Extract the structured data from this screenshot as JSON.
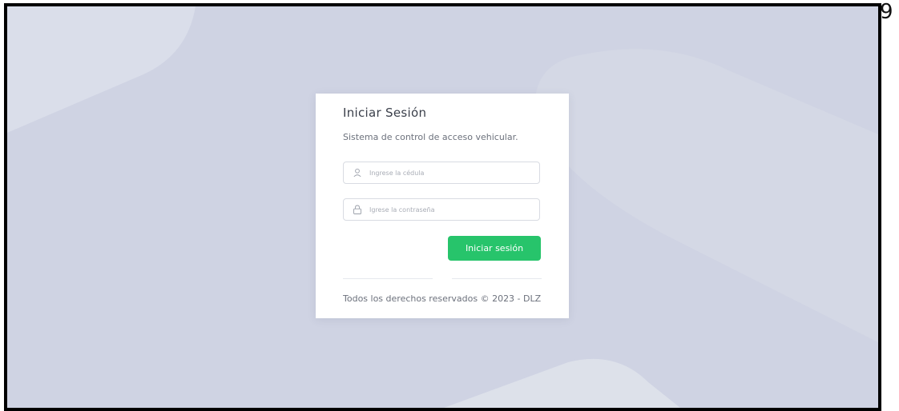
{
  "page_number": "9",
  "login": {
    "title": "Iniciar Sesión",
    "subtitle": "Sistema de control de acceso vehicular.",
    "id_field": {
      "placeholder": "Ingrese la cédula",
      "value": "",
      "icon": "user-icon"
    },
    "password_field": {
      "placeholder": "Igrese la contraseña",
      "value": "",
      "icon": "lock-icon"
    },
    "submit_label": "Iniciar sesión",
    "footer": "Todos los derechos reservados © 2023 - DLZ"
  },
  "colors": {
    "background": "#cfd3e3",
    "card": "#ffffff",
    "accent": "#27c46b",
    "frame_border": "#000000"
  }
}
